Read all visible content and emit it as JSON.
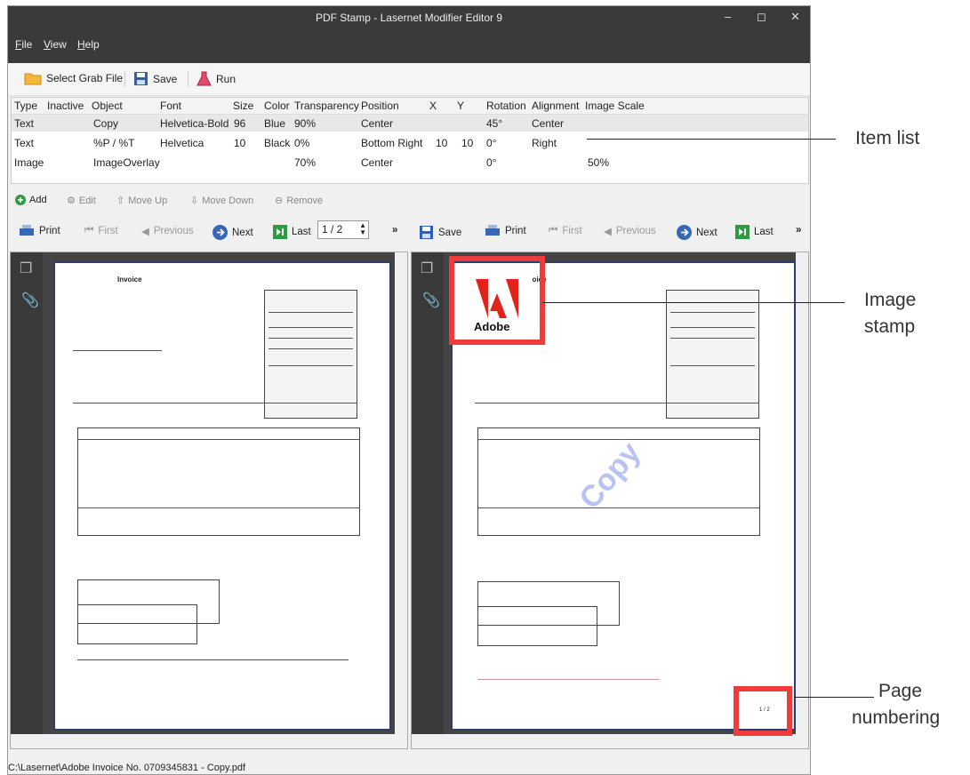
{
  "window": {
    "title": "PDF Stamp - Lasernet Modifier Editor 9"
  },
  "menu": [
    "File",
    "View",
    "Help"
  ],
  "toolbar": {
    "grab_label": "Select Grab File",
    "save_label": "Save",
    "run_label": "Run"
  },
  "grid": {
    "columns": [
      "Type",
      "Inactive",
      "Object",
      "Font",
      "Size",
      "Color",
      "Transparency",
      "Position",
      "X",
      "Y",
      "Rotation",
      "Alignment",
      "Image Scale"
    ],
    "rows": [
      {
        "type": "Text",
        "inactive": "",
        "object": "Copy",
        "font": "Helvetica-Bold",
        "size": "96",
        "color": "Blue",
        "transparency": "90%",
        "position": "Center",
        "x": "",
        "y": "",
        "rotation": "45°",
        "alignment": "Center",
        "scale": ""
      },
      {
        "type": "Text",
        "inactive": "",
        "object": "%P / %T",
        "font": "Helvetica",
        "size": "10",
        "color": "Black",
        "transparency": "0%",
        "position": "Bottom Right",
        "x": "10",
        "y": "10",
        "rotation": "0°",
        "alignment": "Right",
        "scale": ""
      },
      {
        "type": "Image",
        "inactive": "",
        "object": "ImageOverlay",
        "font": "",
        "size": "",
        "color": "",
        "transparency": "70%",
        "position": "Center",
        "x": "",
        "y": "",
        "rotation": "0°",
        "alignment": "",
        "scale": "50%"
      }
    ]
  },
  "actions": {
    "add": "Add",
    "edit": "Edit",
    "move_up": "Move Up",
    "move_down": "Move Down",
    "remove": "Remove"
  },
  "nav_left": {
    "print": "Print",
    "first": "First",
    "previous": "Previous",
    "next": "Next",
    "last": "Last",
    "page": "1 / 2"
  },
  "nav_right": {
    "save": "Save",
    "print": "Print",
    "first": "First",
    "previous": "Previous",
    "next": "Next",
    "last": "Last"
  },
  "overflow": "»",
  "doc": {
    "heading": "Invoice",
    "watermark": "Copy",
    "page_number": "1 / 2",
    "stamp_text": "Adobe"
  },
  "status": "C:\\Lasernet\\Adobe Invoice No. 0709345831 - Copy.pdf",
  "callouts": {
    "item_list": "Item list",
    "image_stamp_1": "Image",
    "image_stamp_2": "stamp",
    "page_numbering_1": "Page",
    "page_numbering_2": "numbering"
  },
  "colors": {
    "titlebar": "#3a3a3a",
    "accent_blue": "#2f5fb3",
    "red_highlight": "#ee3b3b",
    "paper_border": "#2d3e6a"
  }
}
